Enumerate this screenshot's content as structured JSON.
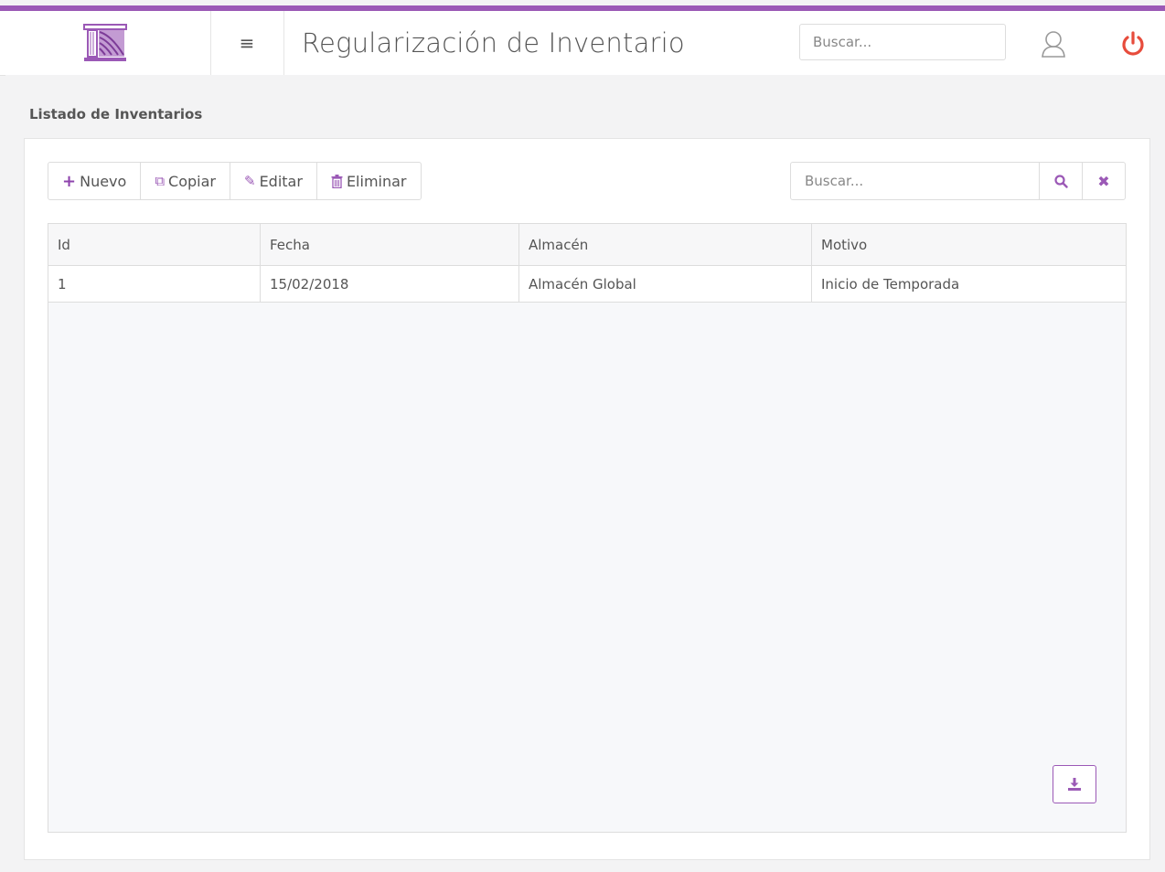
{
  "header": {
    "title": "Regularización de Inventario",
    "search_placeholder": "Buscar...",
    "menu_icon": "hamburger-menu-icon",
    "accent_color": "#9b59b6",
    "power_color": "#e74c3c"
  },
  "section": {
    "title": "Listado de Inventarios"
  },
  "toolbar": {
    "new_label": "Nuevo",
    "copy_label": "Copiar",
    "edit_label": "Editar",
    "delete_label": "Eliminar",
    "search_placeholder": "Buscar..."
  },
  "table": {
    "columns": [
      "Id",
      "Fecha",
      "Almacén",
      "Motivo"
    ],
    "rows": [
      [
        "1",
        "15/02/2018",
        "Almacén Global",
        "Inicio de Temporada"
      ]
    ]
  }
}
